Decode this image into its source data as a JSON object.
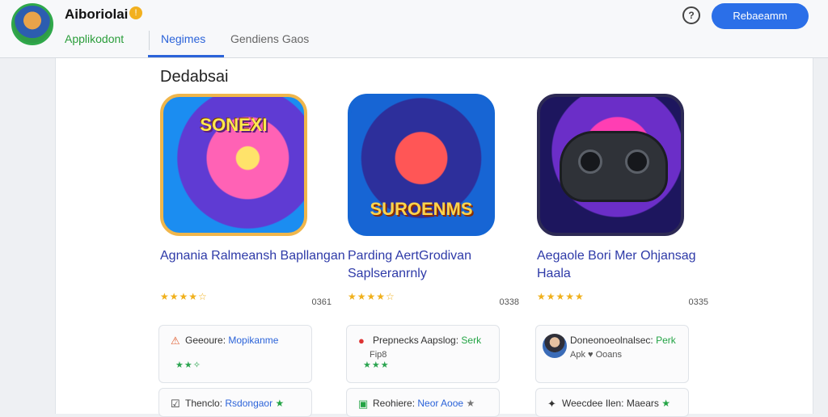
{
  "header": {
    "app_title": "Aiboriolai",
    "app_subtitle": "Applikodont",
    "tabs": [
      {
        "label": "Negimes"
      },
      {
        "label": "Gendiens Gaos"
      }
    ],
    "primary_button": "Rebaeamm"
  },
  "main": {
    "section_title": "Dedabsai",
    "cards": [
      {
        "logo": "SONEXI",
        "title": "Agnania Ralmeansh Bapllangan",
        "rating": "★★★★☆",
        "count": "0361"
      },
      {
        "logo": "SUROENMS",
        "title": "Parding AertGrodivan Saplseranrnly",
        "rating": "★★★★☆",
        "count": "0338"
      },
      {
        "logo": "",
        "title": "Aegaole Bori Mer Ohjansag Haala",
        "rating": "★★★★★",
        "count": "0335"
      }
    ],
    "mini_cards": [
      {
        "text": "Geeoure:",
        "accent": "Mopikanme",
        "icon": "⚠",
        "stars": "★★✧",
        "extra": ""
      },
      {
        "text": "Prepnecks Aapslog:",
        "accent": "Serk",
        "icon": "●",
        "stars": "★★★",
        "extra": "Fip8"
      },
      {
        "text": "Doneonoeolnalsec:",
        "accent": "Perk",
        "icon": "",
        "stars": "",
        "extra": "Apk  ♥  Ooans"
      },
      {
        "text": "Thenclo:",
        "accent": "Rsdongaor",
        "icon": "☑",
        "stars": "★",
        "extra": ""
      },
      {
        "text": "Reohiere:",
        "accent": "Neor Aooe",
        "icon": "▣",
        "stars": "★",
        "extra": ""
      },
      {
        "text": "Weecdee Ilen:",
        "accent": "Maears",
        "icon": "✦",
        "stars": "★",
        "extra": ""
      }
    ]
  },
  "colors": {
    "accent": "#2b63d9",
    "green": "#2aa44f",
    "star": "#f0b01b"
  },
  "icons": {
    "help": "help-icon",
    "verified": "verified-icon",
    "warning": "warning-icon",
    "avatar": "avatar"
  }
}
